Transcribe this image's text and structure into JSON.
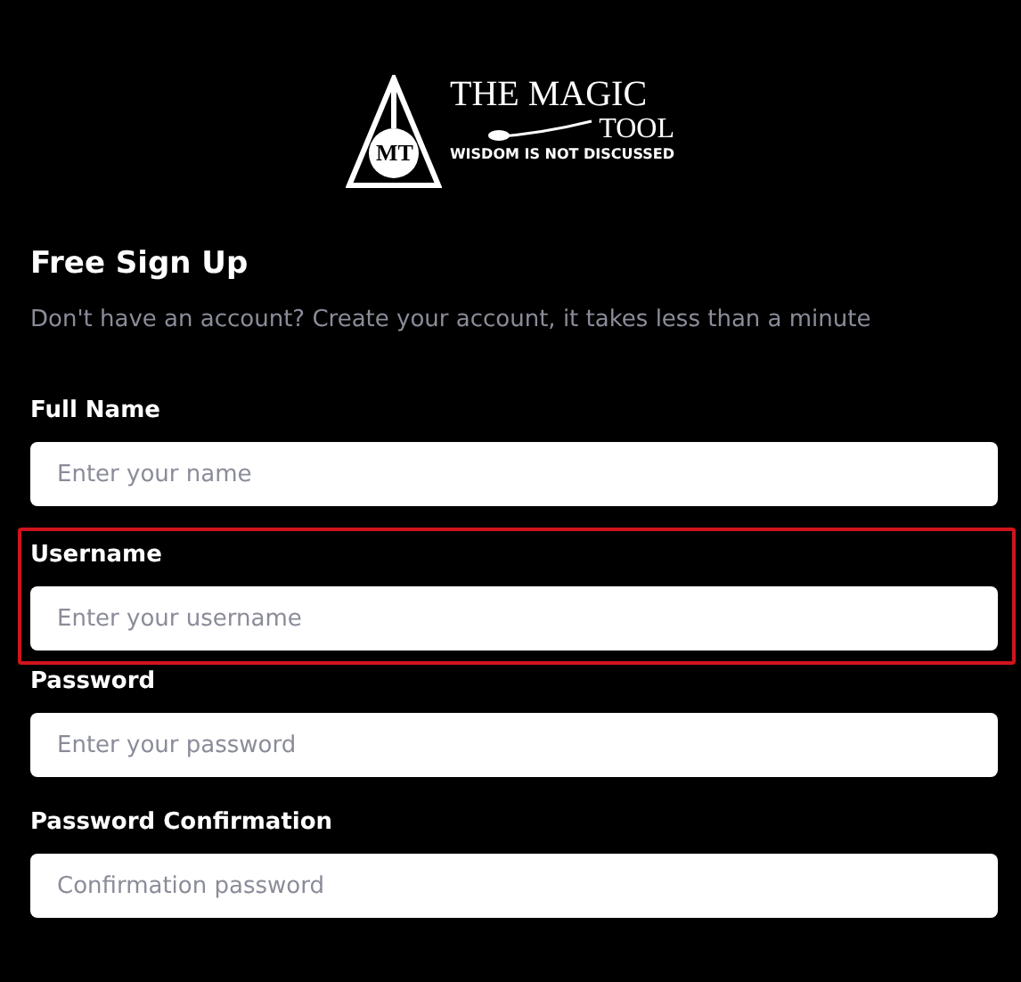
{
  "logo": {
    "monogram": "MT",
    "title": "THE MAGIC",
    "subtitle": "TOOL",
    "tagline": "WISDOM IS NOT DISCUSSED"
  },
  "heading": "Free Sign Up",
  "intro": "Don't have an account? Create your account, it takes less than a minute",
  "fields": [
    {
      "label": "Full Name",
      "placeholder": "Enter your name",
      "highlighted": false
    },
    {
      "label": "Username",
      "placeholder": "Enter your username",
      "highlighted": true
    },
    {
      "label": "Password",
      "placeholder": "Enter your password",
      "highlighted": false
    },
    {
      "label": "Password Confirmation",
      "placeholder": "Confirmation password",
      "highlighted": false
    }
  ]
}
